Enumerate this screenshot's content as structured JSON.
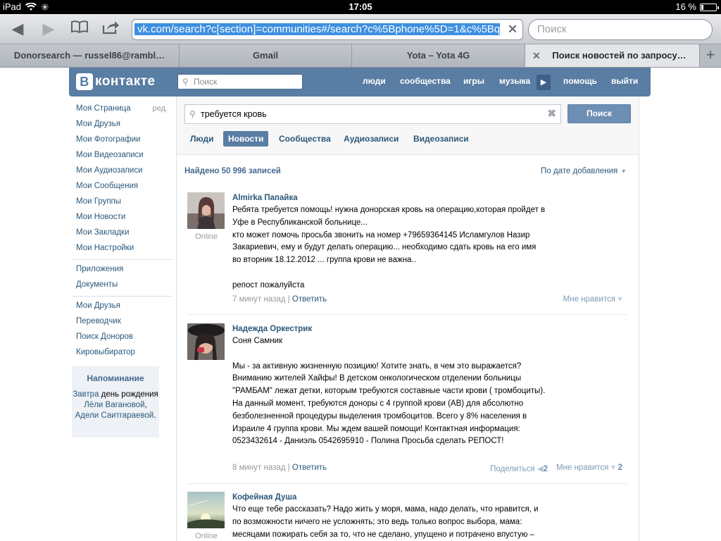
{
  "status_bar": {
    "device": "iPad",
    "time": "17:05",
    "battery": "16 %",
    "battery_level": 0.16
  },
  "browser": {
    "url": "vk.com/search?c[section]=communities#/search?c%5Bphone%5D=1&c%5Bq",
    "url_tail": "5Bq",
    "search_placeholder": "Поиск",
    "tabs": [
      {
        "label": "Donorsearch — russel86@rambl…",
        "active": false
      },
      {
        "label": "Gmail",
        "active": false
      },
      {
        "label": "Yota – Yota 4G",
        "active": false
      },
      {
        "label": "Поиск новостей по запросу…",
        "active": true
      }
    ]
  },
  "vk_header": {
    "logo": "контакте",
    "logo_letter": "В",
    "search_placeholder": "Поиск",
    "nav": [
      "люди",
      "сообщества",
      "игры",
      "музыка",
      "помощь",
      "выйти"
    ]
  },
  "left_menu": {
    "group1": [
      "Моя Страница",
      "Мои Друзья",
      "Мои Фотографии",
      "Мои Видеозаписи",
      "Мои Аудиозаписи",
      "Мои Сообщения",
      "Мои Группы",
      "Мои Новости",
      "Мои Закладки",
      "Мои Настройки"
    ],
    "edit_label": "ред.",
    "group2": [
      "Приложения",
      "Документы"
    ],
    "group3": [
      "Мои Друзья",
      "Переводчик",
      "Поиск Доноров",
      "Кировыбиратор"
    ]
  },
  "reminder": {
    "title": "Напоминание",
    "tomorrow": "Завтра",
    "text1": " день рождения ",
    "name1": "Лёли Вагановой",
    "comma": ", ",
    "name2": "Адели Саитгараевой",
    "end": "."
  },
  "search": {
    "query": "требуется кровь",
    "button": "Поиск",
    "tabs": [
      {
        "label": "Люди",
        "active": false
      },
      {
        "label": "Новости",
        "active": true
      },
      {
        "label": "Сообщества",
        "active": false
      },
      {
        "label": "Аудиозаписи",
        "active": false
      },
      {
        "label": "Видеозаписи",
        "active": false
      }
    ],
    "found": "Найдено 50 996 записей",
    "sort": "По дате добавления"
  },
  "posts": [
    {
      "author": "Almirka Папайка",
      "online": "Online",
      "text": "Ребята требуется помощь! нужна донорская кровь на операцию,которая пройдет в Уфе в Республиканской больнице...\nкто может помочь просьба звонить на номер +79659364145 Исламгулов Назир Закариевич, ему и будут делать операцию... необходимо сдать кровь на его имя во вторник 18.12.2012 ... группа крови не важна..\n\nрепост пожалуйста",
      "time": "7 минут назад",
      "sep": " | ",
      "reply": "Ответить",
      "like": "Мне нравится",
      "like_count": "",
      "share": "",
      "share_count": ""
    },
    {
      "author": "Надежда Оркестрик",
      "online": "",
      "text": "Соня Самник\n\nМы - за активную жизненную позицию! Хотите знать, в чем это выражается? Вниманию жителей Хайфы! В детском онкологическом отделении больницы \"РАМБАМ\" лежат детки, которым требуются составные части крови ( тромбоциты). На данный момент, требуются доноры с 4 группой крови (АВ) для абсолютно безболезненной процедуры выделения тромбоцитов. Всего у 8% населения в Израиле 4 группа крови. Мы ждем вашей помощи! Контактная информация: 0523432614 - Даниэль 0542695910 - Полина Просьба сделать РЕПОСТ!",
      "time": "8 минут назад",
      "sep": " | ",
      "reply": "Ответить",
      "like": "Мне нравится",
      "like_count": "2",
      "share": "Поделиться",
      "share_count": "2"
    },
    {
      "author": "Кофейная Душа",
      "online": "Online",
      "text": "Что еще тебе рассказать? Надо жить у моря, мама, надо делать, что нравится, и по возможности ничего не усложнять; это ведь только вопрос выбора, мама: месяцами пожирать себя за то, что не сделано, упущено и потрачено впустую –"
    }
  ],
  "colors": {
    "vk_blue": "#597da3",
    "link": "#2b587a",
    "selection": "#3d8fe0"
  }
}
